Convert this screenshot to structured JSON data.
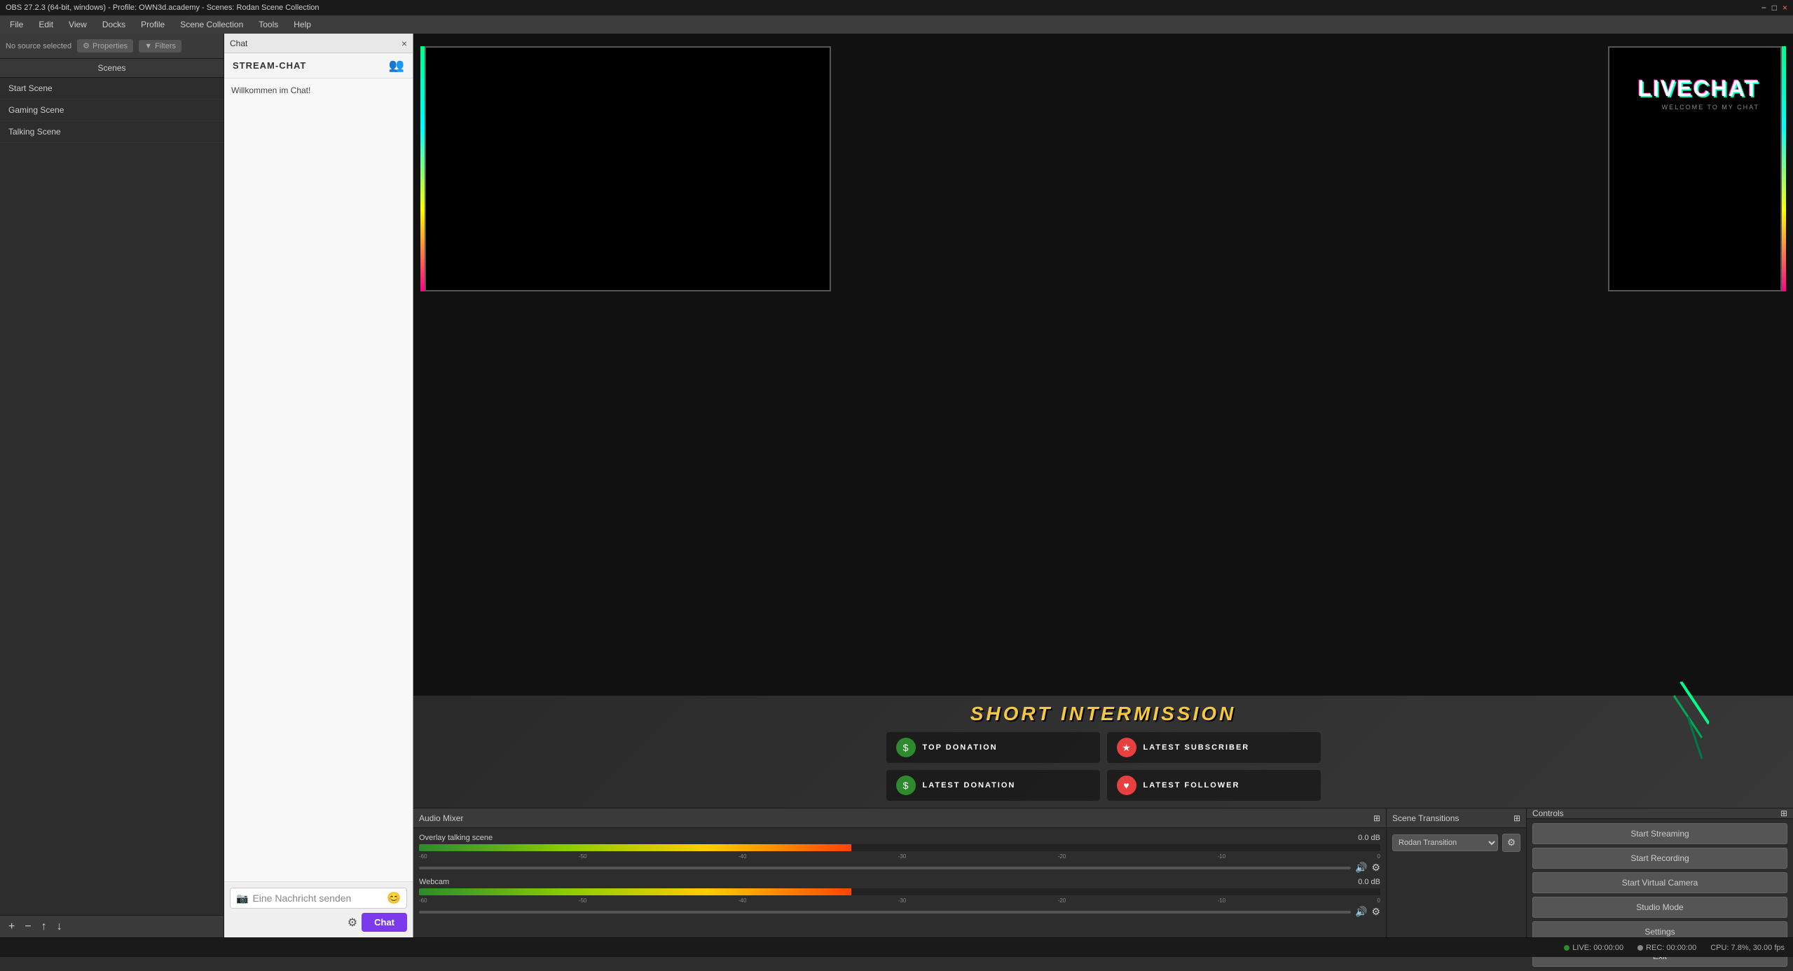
{
  "titleBar": {
    "title": "OBS 27.2.3 (64-bit, windows) - Profile: OWN3d.academy - Scenes: Rodan Scene Collection",
    "minimize": "−",
    "maximize": "□",
    "close": "×"
  },
  "menuBar": {
    "items": [
      "File",
      "Edit",
      "View",
      "Docks",
      "Profile",
      "Scene Collection",
      "Tools",
      "Help"
    ]
  },
  "sourceBar": {
    "label": "No source selected",
    "properties": "Properties",
    "filters": "Filters"
  },
  "scenes": {
    "header": "Scenes",
    "items": [
      "Start Scene",
      "Gaming Scene",
      "Talking Scene"
    ],
    "toolbar": {
      "add": "+",
      "remove": "−",
      "up": "↑",
      "down": "↓"
    }
  },
  "chatPanel": {
    "title": "Chat",
    "closeBtn": "×",
    "streamChatTitle": "STREAM-CHAT",
    "welcomeMsg": "Willkommen im Chat!",
    "inputPlaceholder": "Eine Nachricht senden",
    "sendBtn": "Chat",
    "settingsIcon": "⚙",
    "emojiIcon": "😊",
    "cameraIcon": "📹"
  },
  "preview": {
    "livechatLogo": "LIVECHAT",
    "livechatSub": "WELCOME TO MY CHAT",
    "intermissionTitle": "SHORT INTERMISSION",
    "infoCards": [
      {
        "label": "TOP DONATION",
        "iconType": "green"
      },
      {
        "label": "LATEST SUBSCRIBER",
        "iconType": "red"
      },
      {
        "label": "LATEST DONATION",
        "iconType": "green"
      },
      {
        "label": "LATEST FOLLOWER",
        "iconType": "red"
      }
    ]
  },
  "audioMixer": {
    "header": "Audio Mixer",
    "maximizeIcon": "⊞",
    "channels": [
      {
        "name": "Overlay talking scene",
        "db": "0.0 dB",
        "meterWidth": "45%"
      },
      {
        "name": "Webcam",
        "db": "0.0 dB",
        "meterWidth": "45%"
      }
    ],
    "meterLabels": [
      "-60",
      "-50",
      "-40",
      "-30",
      "-20",
      "-10",
      "0"
    ],
    "volIcon": "🔊",
    "settingsIcon": "⚙"
  },
  "sceneTransitions": {
    "header": "Scene Transitions",
    "maximizeIcon": "⊞",
    "transitionName": "Rodan Transition",
    "settingsIcon": "⚙"
  },
  "controls": {
    "header": "Controls",
    "maximizeIcon": "⊞",
    "buttons": [
      "Start Streaming",
      "Start Recording",
      "Start Virtual Camera",
      "Studio Mode",
      "Settings",
      "Exit"
    ]
  },
  "statusBar": {
    "live": "LIVE: 00:00:00",
    "rec": "REC: 00:00:00",
    "cpu": "CPU: 7.8%, 30.00 fps"
  }
}
